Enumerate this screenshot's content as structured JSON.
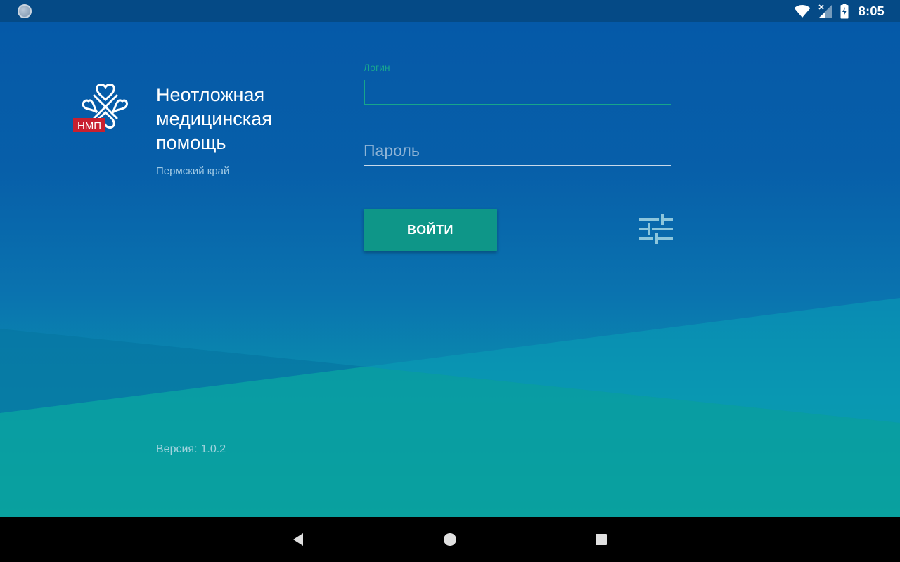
{
  "status_bar": {
    "time": "8:05",
    "icons": [
      "notification-dot-icon",
      "wifi-icon",
      "cell-signal-icon",
      "battery-charging-icon"
    ]
  },
  "brand": {
    "logo_text": "НМП",
    "title": "Неотложная\nмедицинская\nпомощь",
    "region": "Пермский край"
  },
  "login_form": {
    "login_label": "Логин",
    "login_value": "",
    "password_placeholder": "Пароль",
    "submit_label": "ВОЙТИ",
    "settings_icon": "tune-icon"
  },
  "footer": {
    "version_label": "Версия:",
    "version_value": "1.0.2"
  },
  "nav_bar": {
    "icons": [
      "back-icon",
      "home-icon",
      "recents-icon"
    ]
  },
  "colors": {
    "status_bar": "#054a86",
    "accent": "#17a58b",
    "button": "#0e9688",
    "logo_badge": "#c8202f"
  }
}
